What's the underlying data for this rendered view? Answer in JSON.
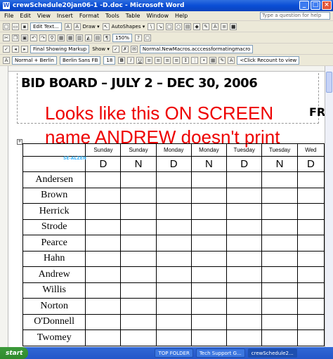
{
  "window": {
    "title": "crewSchedule20jan06-1 -D.doc - Microsoft Word"
  },
  "menu": [
    "File",
    "Edit",
    "View",
    "Insert",
    "Format",
    "Tools",
    "Table",
    "Window",
    "Help"
  ],
  "help": {
    "placeholder": "Type a question for help"
  },
  "toolbar": {
    "edit_text": "Edit Text...",
    "draw": "Draw ▾",
    "autoshapes": "AutoShapes ▾",
    "zoom": "150%",
    "markup": "Final Showing Markup",
    "show": "Show ▾",
    "macro": "Normal.NewMacros.acccessformatingmacro",
    "style": "Normal + Berlin",
    "font": "Berlin Sans FB",
    "size": "18",
    "recount": "<Click Recount to view"
  },
  "document": {
    "header_title": "BID BOARD – JULY 2 – DEC 30, 2006",
    "fr": "FR",
    "note_line1": "Looks like this ON SCREEN",
    "note_line2": "name ANDREW doesn't print",
    "hidden_name": "SE-ALZEN",
    "days": [
      "Sunday",
      "Sunday",
      "Monday",
      "Monday",
      "Tuesday",
      "Tuesday",
      "Wed"
    ],
    "codes": [
      "D",
      "N",
      "D",
      "N",
      "D",
      "N",
      "D"
    ],
    "names": [
      "Andersen",
      "Brown",
      "Herrick",
      "Strode",
      "Pearce",
      "Hahn",
      "Andrew",
      "Willis",
      "Norton",
      "O'Donnell",
      "Twomey"
    ]
  },
  "taskbar": {
    "start": "start",
    "items": [
      "TOP FOLDER",
      "Tech Support G...",
      "crewSchedule2..."
    ]
  }
}
